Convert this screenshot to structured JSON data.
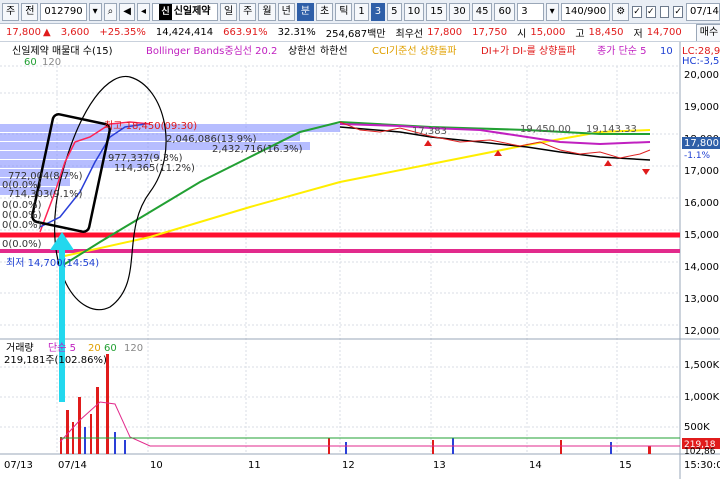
{
  "toolbar": {
    "market": "주",
    "order_type": "전",
    "code": "012790",
    "name_badge": "신",
    "name": "신일제약",
    "periods": [
      "일",
      "주",
      "월",
      "년",
      "분",
      "초",
      "틱"
    ],
    "period_selected": "분",
    "intervals": [
      "1",
      "3",
      "5",
      "10",
      "15",
      "30",
      "45",
      "60"
    ],
    "interval_selected": "3",
    "interval_combo": "3",
    "counter": "140/900",
    "date": "07/14"
  },
  "quote": {
    "price": "17,800",
    "change_arrow": "▲",
    "change": "3,600",
    "change_rate": "+25.35%",
    "volume": "14,424,414",
    "vol_ratio": "663.91%",
    "turnover": "32.31%",
    "amount": "254,687백만",
    "best_label": "최우선",
    "best_ask": "17,800",
    "best_bid": "17,750",
    "open_label": "시",
    "open": "15,000",
    "high_label": "고",
    "high": "18,450",
    "low_label": "저",
    "low": "14,700",
    "buy_button": "매수",
    "sell_button": "매"
  },
  "legend": {
    "title": "신일제약 매물대 수(15)",
    "bollinger": "Bollinger Bands중심선 20.2",
    "upper": "상한선",
    "lower": "하한선",
    "cci": "CCI기준선 상향돌파",
    "di": "DI+가 DI-를 상향돌파",
    "close_ma": "종가 단순 5",
    "ma10": "10",
    "ma60": "60",
    "ma120": "120",
    "lc": "LC:28,9",
    "hc": "HC:-3,5"
  },
  "price_axis": {
    "labels": [
      "20,000",
      "19,000",
      "18,000",
      "17,000",
      "16,000",
      "15,000",
      "14,000",
      "13,000",
      "12,000"
    ],
    "current_price": "17,800",
    "current_change": "-1.1%"
  },
  "annotations": {
    "high_label": "최고 18,450(09:30)",
    "vp1": "2,046,086(13.9%)",
    "vp2": "2,432,716(16.3%)",
    "vp3": "977,337(9.3%)",
    "vp4": "114,365(11.2%)",
    "vp5": "772,004(8.7%)",
    "vp6": "714,303(9.1%)",
    "zero_labels": [
      "0(0.0%)",
      "0(0.0%)",
      "0(0.0%)",
      "0(0.0%)",
      "0(0.0%)"
    ],
    "low_label": "최저 14,700(14:54)",
    "right_high": "19,143.33",
    "right_mid": "19,450.00",
    "right_low": "17,383"
  },
  "volume_panel": {
    "title": "거래량",
    "ma_label": "단순 5",
    "ma20": "20",
    "ma60": "60",
    "ma120": "120",
    "current": "219,181주(102.86%)",
    "axis_labels": [
      "1,500K",
      "1,000K",
      "500K"
    ],
    "last_value": "219,18",
    "last_ma": "102,86"
  },
  "time_axis": {
    "labels": [
      "07/13",
      "07/14",
      "10",
      "11",
      "12",
      "13",
      "14",
      "15"
    ],
    "right_time": "15:30:0"
  },
  "colors": {
    "up": "#e01b1b",
    "down": "#1d3fd3",
    "bollinger_mid": "#c020c0",
    "ma5": "#ffee00",
    "ma20": "#22a033",
    "support_red": "#ff1030",
    "support_pink": "#e22a8c",
    "highlight_box": "#000000",
    "arrow": "#22d8ee"
  }
}
